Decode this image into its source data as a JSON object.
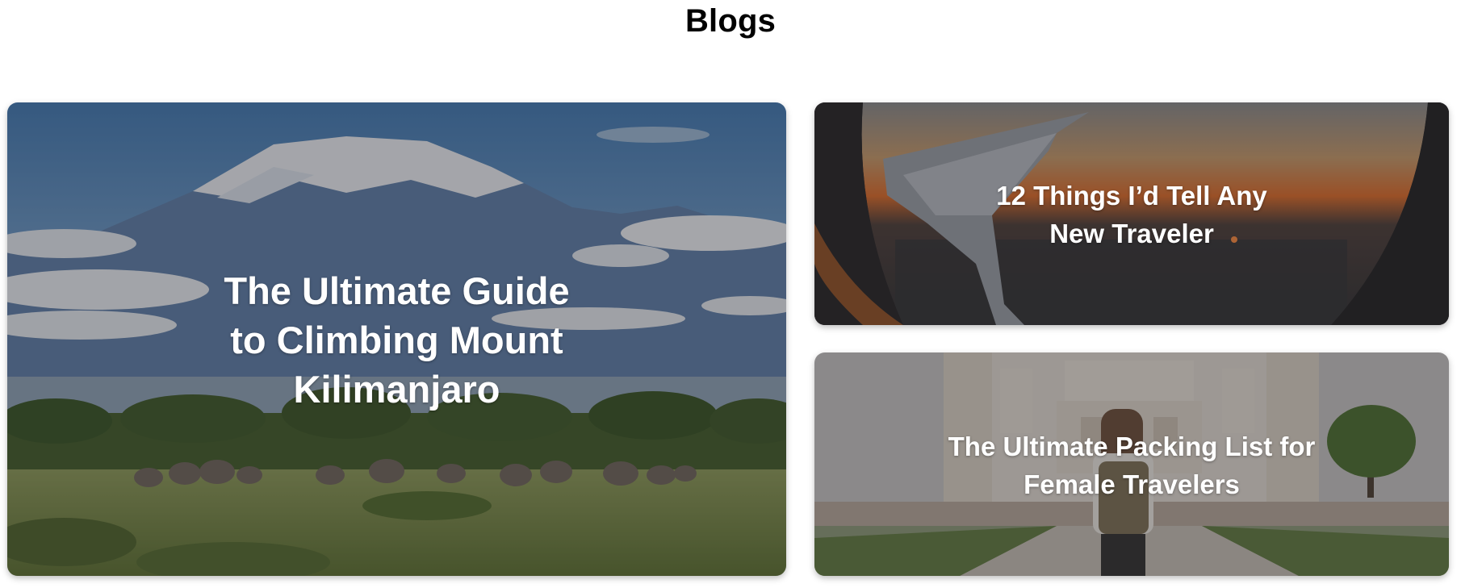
{
  "page": {
    "title": "Blogs"
  },
  "blogs": [
    {
      "title": "The Ultimate Guide to Climbing Mount Kilimanjaro"
    },
    {
      "title": "12 Things I’d Tell Any New Traveler"
    },
    {
      "title": "The Ultimate Packing List for Female Travelers"
    }
  ],
  "colors": {
    "background": "#ffffff",
    "title": "#000000",
    "card_text": "#ffffff",
    "overlay": "#28282d"
  },
  "images": [
    {
      "icon": "kilimanjaro-savanna-photo"
    },
    {
      "icon": "airplane-window-wing-sunset-photo"
    },
    {
      "icon": "traveler-at-monument-photo"
    }
  ]
}
